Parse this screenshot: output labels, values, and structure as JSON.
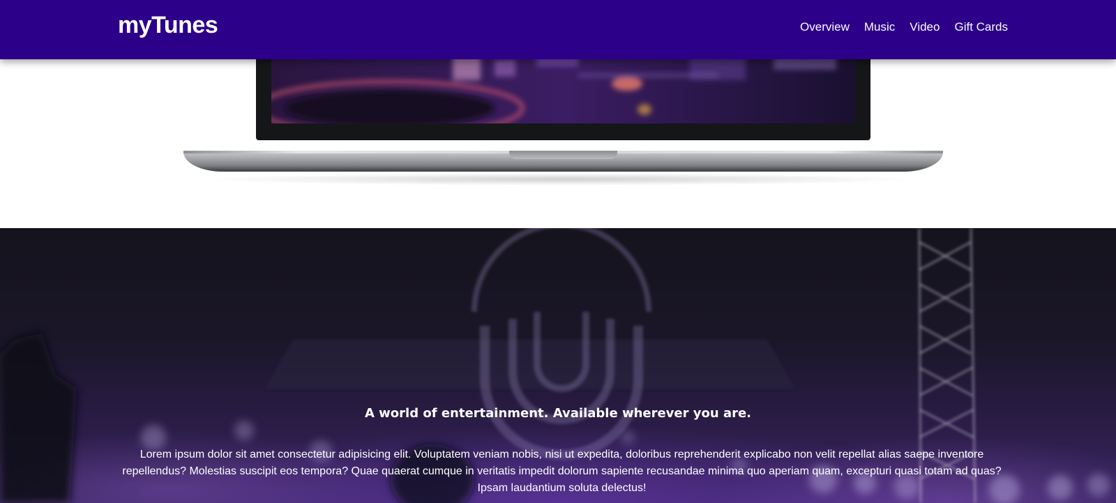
{
  "header": {
    "brand": "myTunes",
    "nav": [
      {
        "label": "Overview"
      },
      {
        "label": "Music"
      },
      {
        "label": "Video"
      },
      {
        "label": "Gift Cards"
      }
    ]
  },
  "hero": {
    "title": "A world of entertainment. Available wherever you are.",
    "body": "Lorem ipsum dolor sit amet consectetur adipisicing elit. Voluptatem veniam nobis, nisi ut expedita, doloribus reprehenderit explicabo non velit repellat alias saepe inventore repellendus? Molestias suscipit eos tempora? Quae quaerat cumque in veritatis impedit dolorum sapiente recusandae minima quo aperiam quam, excepturi quasi totam ad quas? Ipsam laudantium soluta delectus!"
  },
  "colors": {
    "navbar": "#2c0089",
    "accent_purple": "#6a3cbf"
  }
}
